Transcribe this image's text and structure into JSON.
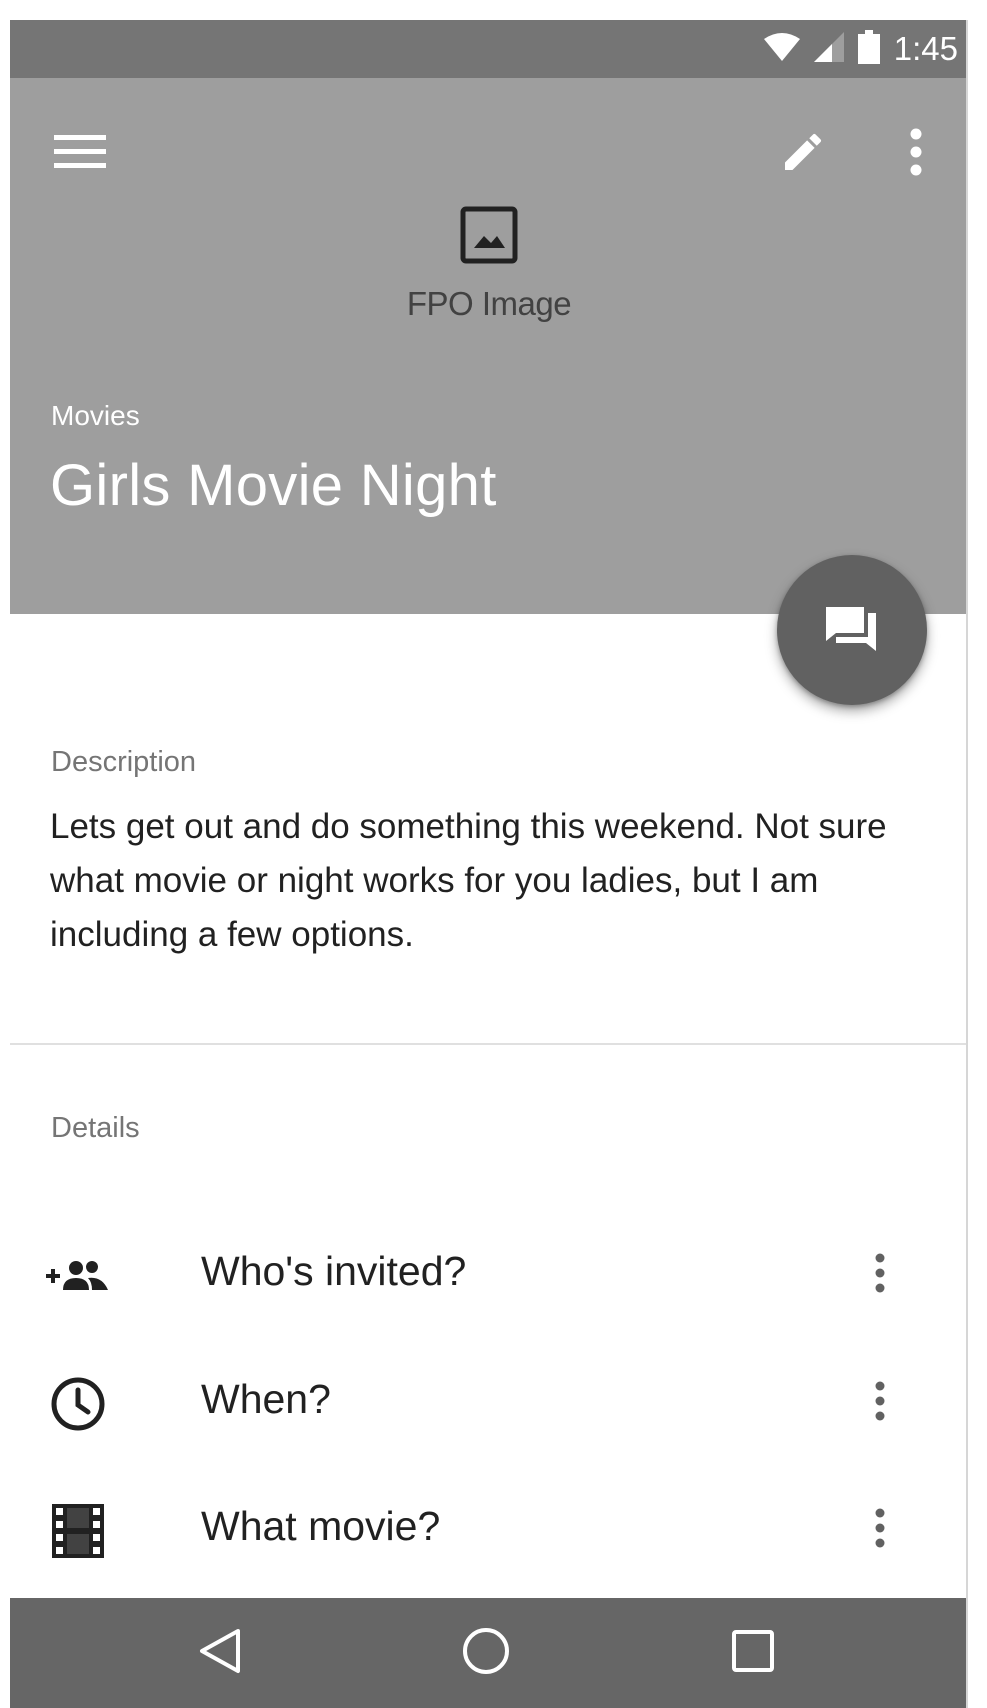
{
  "status_bar": {
    "time": "1:45",
    "icons": [
      "wifi-icon",
      "cell-signal-icon",
      "battery-icon"
    ]
  },
  "app_bar": {
    "icons": [
      "menu-icon",
      "edit-icon",
      "more-vert-icon"
    ],
    "image_placeholder_label": "FPO Image",
    "category": "Movies",
    "title": "Girls Movie Night"
  },
  "fab": {
    "icon": "forum-icon"
  },
  "description": {
    "label": "Description",
    "text": "Lets get out and do something this weekend. Not sure what movie or night works for you ladies, but I am including a few options."
  },
  "details": {
    "label": "Details",
    "items": [
      {
        "icon": "group-add-icon",
        "label": "Who's invited?"
      },
      {
        "icon": "clock-icon",
        "label": "When?"
      },
      {
        "icon": "movie-film-icon",
        "label": "What movie?"
      }
    ]
  },
  "nav_bar": {
    "icons": [
      "back-icon",
      "home-icon",
      "recents-icon"
    ]
  },
  "colors": {
    "status_bar": "#757575",
    "header": "#9e9e9e",
    "fab": "#616161",
    "nav_bar": "#666666"
  }
}
